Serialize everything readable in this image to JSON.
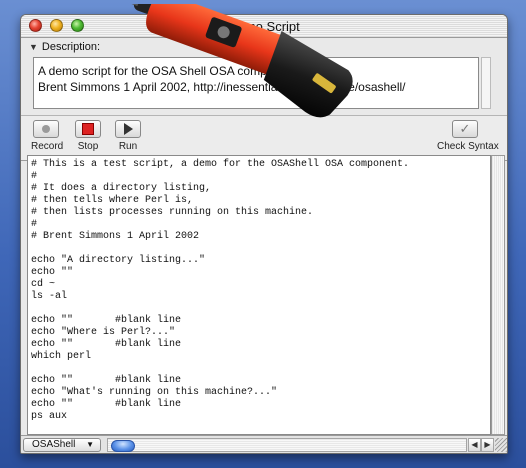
{
  "window": {
    "title": "Demo Script",
    "traffic_lights": [
      "close",
      "minimize",
      "zoom"
    ]
  },
  "description": {
    "label": "Description:",
    "disclosure_icon": "triangle-down-icon",
    "lines": [
      "A demo script for the OSA Shell OSA component.",
      "Brent Simmons 1 April 2002, http://inessential.com/software/osashell/"
    ]
  },
  "toolbar": {
    "record_label": "Record",
    "stop_label": "Stop",
    "run_label": "Run",
    "check_syntax_label": "Check Syntax"
  },
  "script": {
    "lines": [
      "# This is a test script, a demo for the OSAShell OSA component.",
      "#",
      "# It does a directory listing,",
      "# then tells where Perl is,",
      "# then lists processes running on this machine.",
      "#",
      "# Brent Simmons 1 April 2002",
      "",
      "echo \"A directory listing...\"",
      "echo \"\"",
      "cd ~",
      "ls -al",
      "",
      "echo \"\"       #blank line",
      "echo \"Where is Perl?...\"",
      "echo \"\"       #blank line",
      "which perl",
      "",
      "echo \"\"       #blank line",
      "echo \"What's running on this machine?...\"",
      "echo \"\"       #blank line",
      "ps aux"
    ]
  },
  "bottom": {
    "language_popup": "OSAShell"
  },
  "colors": {
    "desktop": "#3f67b8",
    "window_bg": "#e9e9e9",
    "stop_red": "#dd2222",
    "scroll_thumb": "#5b92e8"
  }
}
